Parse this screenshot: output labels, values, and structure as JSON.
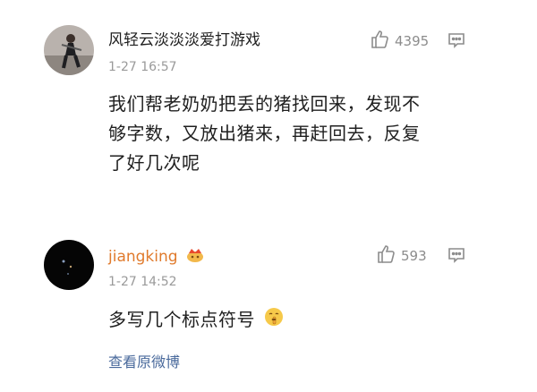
{
  "comments": [
    {
      "username": "风轻云淡淡淡爱打游戏",
      "time": "1-27 16:57",
      "likes": "4395",
      "text_lines": [
        "我们帮老奶奶把丢的猪找回来，发现不",
        "够字数，又放出猪来，再赶回去，反复",
        "了好几次呢"
      ],
      "icons": {
        "like": "thumbs-up-icon",
        "reply": "comment-icon"
      }
    },
    {
      "username": "jiangking",
      "username_color": "#e07a2c",
      "badge_icon": "crown-badge-icon",
      "time": "1-27 14:52",
      "likes": "593",
      "text": "多写几个标点符号",
      "emoji_icon": "shush-emoji-icon",
      "icons": {
        "like": "thumbs-up-icon",
        "reply": "comment-icon"
      }
    }
  ],
  "view_original": "查看原微博",
  "colors": {
    "meta": "#9a9a9a",
    "link": "#4a6a9c",
    "text": "#1f1f1f"
  }
}
